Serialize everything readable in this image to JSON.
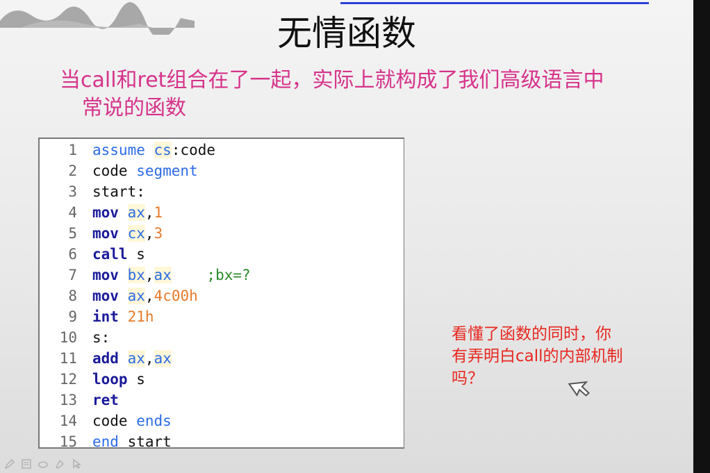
{
  "slide": {
    "title": "无情函数",
    "subtitle_line1": "当call和ret组合在了一起，实际上就构成了我们高级语言中",
    "subtitle_line2": "常说的函数",
    "note_line1": "看懂了函数的同时，你",
    "note_line2": "有弄明白call的内部机制",
    "note_line3": "吗？",
    "colors": {
      "subtitle": "#d6338a",
      "note": "#e8271f",
      "accent_line": "#2b3fd6"
    }
  },
  "code": {
    "lines": [
      {
        "n": "1",
        "indent": false,
        "tokens": [
          {
            "t": "assume",
            "c": "kw-blue"
          },
          {
            "t": " ",
            "c": "plain"
          },
          {
            "t": "cs",
            "c": "reg"
          },
          {
            "t": ":code",
            "c": "plain"
          }
        ]
      },
      {
        "n": "2",
        "indent": false,
        "tokens": [
          {
            "t": "code ",
            "c": "plain"
          },
          {
            "t": "segment",
            "c": "kw-blue"
          }
        ]
      },
      {
        "n": "3",
        "indent": false,
        "tokens": [
          {
            "t": "start:",
            "c": "plain"
          }
        ]
      },
      {
        "n": "4",
        "indent": true,
        "tokens": [
          {
            "t": "mov",
            "c": "kw-bold"
          },
          {
            "t": " ",
            "c": "plain"
          },
          {
            "t": "ax",
            "c": "reg"
          },
          {
            "t": ",",
            "c": "plain"
          },
          {
            "t": "1",
            "c": "num"
          }
        ]
      },
      {
        "n": "5",
        "indent": true,
        "tokens": [
          {
            "t": "mov",
            "c": "kw-bold"
          },
          {
            "t": " ",
            "c": "plain"
          },
          {
            "t": "cx",
            "c": "reg"
          },
          {
            "t": ",",
            "c": "plain"
          },
          {
            "t": "3",
            "c": "num"
          }
        ]
      },
      {
        "n": "6",
        "indent": true,
        "tokens": [
          {
            "t": "call",
            "c": "kw-bold"
          },
          {
            "t": " s",
            "c": "plain"
          }
        ]
      },
      {
        "n": "7",
        "indent": true,
        "tokens": [
          {
            "t": "mov",
            "c": "kw-bold"
          },
          {
            "t": " ",
            "c": "plain"
          },
          {
            "t": "bx",
            "c": "reg"
          },
          {
            "t": ",",
            "c": "plain"
          },
          {
            "t": "ax",
            "c": "reg"
          },
          {
            "t": "    ",
            "c": "plain"
          },
          {
            "t": ";bx=?",
            "c": "comment"
          }
        ]
      },
      {
        "n": "8",
        "indent": true,
        "tokens": [
          {
            "t": "mov",
            "c": "kw-bold"
          },
          {
            "t": " ",
            "c": "plain"
          },
          {
            "t": "ax",
            "c": "reg"
          },
          {
            "t": ",",
            "c": "plain"
          },
          {
            "t": "4c00h",
            "c": "num"
          }
        ]
      },
      {
        "n": "9",
        "indent": true,
        "tokens": [
          {
            "t": "int",
            "c": "kw-bold"
          },
          {
            "t": " ",
            "c": "plain"
          },
          {
            "t": "21h",
            "c": "num"
          }
        ]
      },
      {
        "n": "10",
        "indent": false,
        "tokens": [
          {
            "t": "s:",
            "c": "plain"
          }
        ]
      },
      {
        "n": "11",
        "indent": true,
        "tokens": [
          {
            "t": "add",
            "c": "kw-bold"
          },
          {
            "t": " ",
            "c": "plain"
          },
          {
            "t": "ax",
            "c": "reg"
          },
          {
            "t": ",",
            "c": "plain"
          },
          {
            "t": "ax",
            "c": "reg"
          }
        ]
      },
      {
        "n": "12",
        "indent": true,
        "tokens": [
          {
            "t": "loop",
            "c": "kw-bold"
          },
          {
            "t": " s",
            "c": "plain"
          }
        ]
      },
      {
        "n": "13",
        "indent": true,
        "tokens": [
          {
            "t": "ret",
            "c": "kw-bold"
          }
        ]
      },
      {
        "n": "14",
        "indent": false,
        "tokens": [
          {
            "t": "code ",
            "c": "plain"
          },
          {
            "t": "ends",
            "c": "kw-blue"
          }
        ]
      },
      {
        "n": "15",
        "indent": false,
        "tokens": [
          {
            "t": "end",
            "c": "kw-blue"
          },
          {
            "t": " start",
            "c": "plain"
          }
        ]
      }
    ]
  },
  "toolbar": {
    "icons": [
      "pen-icon",
      "slides-icon",
      "eraser-icon",
      "highlighter-icon",
      "pointer-icon"
    ]
  }
}
